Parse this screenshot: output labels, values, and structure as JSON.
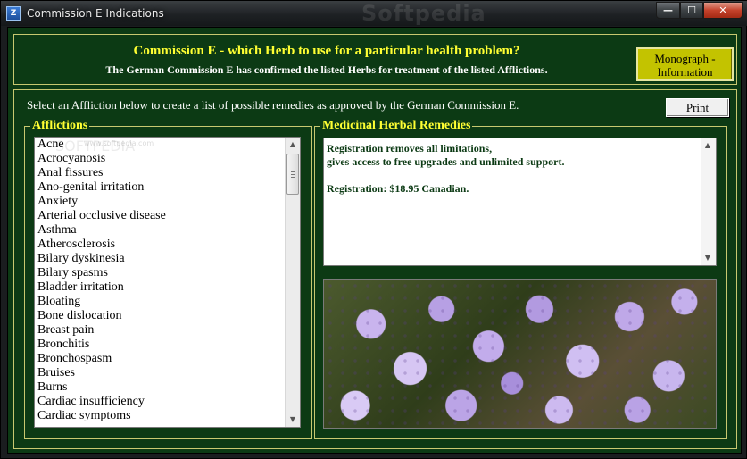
{
  "window": {
    "title": "Commission E Indications",
    "app_icon": "Z",
    "watermark": "Softpedia",
    "controls": {
      "minimize": "—",
      "maximize": "☐",
      "close": "✕"
    }
  },
  "header": {
    "title": "Commission E - which Herb to use for a particular health problem?",
    "subtitle": "The German Commission E has confirmed the listed Herbs for treatment of the listed Afflictions.",
    "monograph_button": "Monograph - Information"
  },
  "instruction": "Select an Affliction below to create a list of possible remedies as approved by the German Commission E.",
  "print_button": "Print",
  "afflictions": {
    "legend": "Afflictions",
    "watermark": "SOFTPEDIA",
    "watermark_url": "www.softpedia.com",
    "items": [
      "Acne",
      "Acrocyanosis",
      "Anal fissures",
      "Ano-genital irritation",
      "Anxiety",
      "Arterial occlusive disease",
      "Asthma",
      "Atherosclerosis",
      "Bilary dyskinesia",
      "Bilary spasms",
      "Bladder irritation",
      "Bloating",
      "Bone dislocation",
      "Breast pain",
      "Bronchitis",
      "Bronchospasm",
      "Bruises",
      "Burns",
      "Cardiac insufficiency",
      "Cardiac symptoms"
    ]
  },
  "remedies": {
    "legend": "Medicinal Herbal Remedies",
    "line1": "Registration removes all limitations,",
    "line2": "gives access to free upgrades and unlimited support.",
    "line3": "Registration: $18.95 Canadian."
  },
  "colors": {
    "background": "#0c3a14",
    "accent_yellow": "#ffff33",
    "button_olive": "#c3c300"
  }
}
